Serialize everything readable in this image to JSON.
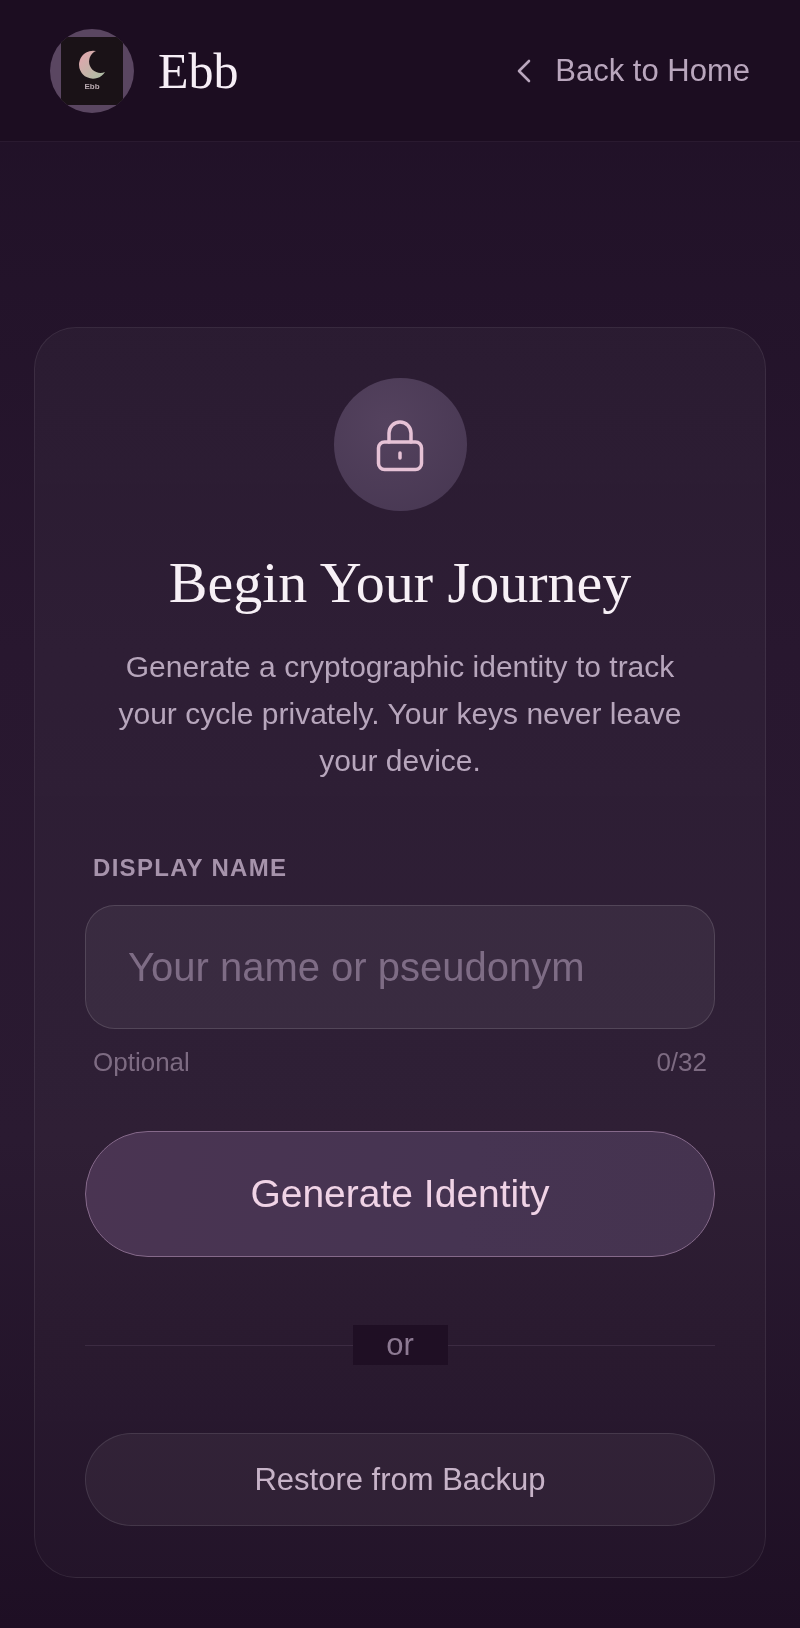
{
  "header": {
    "logo": {
      "caption": "Ebb"
    },
    "brand": "Ebb",
    "back_link": "Back to Home"
  },
  "card": {
    "title": "Begin Your Journey",
    "description": "Generate a cryptographic identity to track your cycle privately. Your keys never leave your device.",
    "field": {
      "label": "DISPLAY NAME",
      "placeholder": "Your name or pseudonym",
      "hint": "Optional",
      "counter": "0/32"
    },
    "primary_button": "Generate Identity",
    "separator": "or",
    "secondary_button": "Restore from Backup"
  }
}
